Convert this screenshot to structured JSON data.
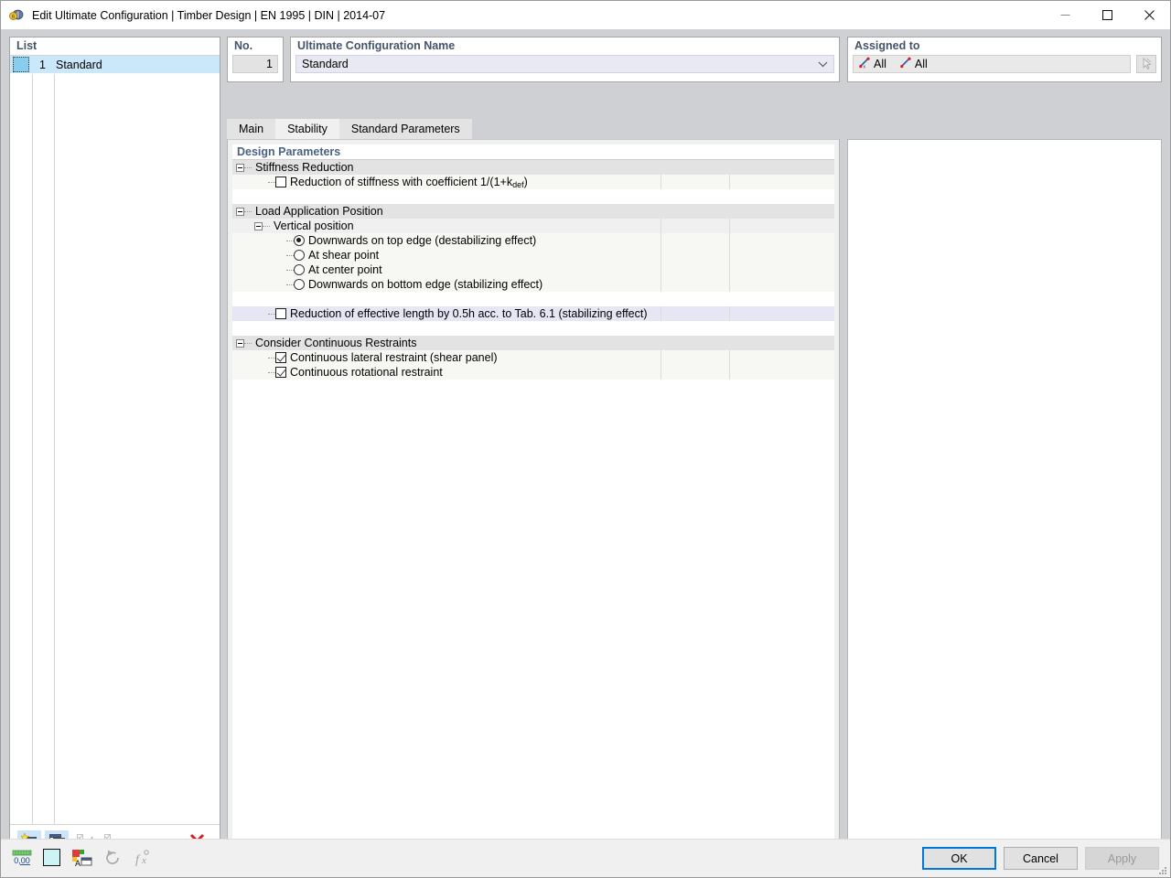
{
  "window": {
    "title": "Edit Ultimate Configuration | Timber Design | EN 1995 | DIN | 2014-07",
    "icon": "app-icon",
    "minimize": "—",
    "maximize": "□",
    "close": "✕"
  },
  "list": {
    "header": "List",
    "rows": [
      {
        "num": "1",
        "name": "Standard"
      }
    ],
    "toolbar": [
      {
        "name": "new-configuration-button",
        "label": ""
      },
      {
        "name": "copy-configuration-button",
        "label": ""
      },
      {
        "name": "select-all-button",
        "label": ""
      },
      {
        "name": "deselect-button",
        "label": ""
      },
      {
        "name": "delete-configuration-button",
        "label": "✕"
      }
    ]
  },
  "number_field": {
    "label": "No.",
    "value": "1"
  },
  "name_field": {
    "label": "Ultimate Configuration Name",
    "value": "Standard"
  },
  "assigned": {
    "label": "Assigned to",
    "items": [
      {
        "icon": "member-icon",
        "text": "All"
      },
      {
        "icon": "surface-icon",
        "text": "All"
      }
    ],
    "pick_icon": "pick-cursor-icon"
  },
  "tabs": [
    {
      "label": "Main",
      "active": false
    },
    {
      "label": "Stability",
      "active": true
    },
    {
      "label": "Standard Parameters",
      "active": false
    }
  ],
  "table": {
    "title": "Design Parameters",
    "rows": [
      {
        "kind": "group",
        "indent": 0,
        "label": "Stiffness Reduction"
      },
      {
        "kind": "check",
        "indent": 2,
        "label": "Reduction of stiffness with coefficient 1/(1+k",
        "sub": "def",
        "label_tail": ")",
        "checked": false
      },
      {
        "kind": "blank"
      },
      {
        "kind": "group",
        "indent": 0,
        "label": "Load Application Position"
      },
      {
        "kind": "sub",
        "indent": 1,
        "label": "Vertical position"
      },
      {
        "kind": "radio",
        "indent": 3,
        "label": "Downwards on top edge (destabilizing effect)",
        "selected": true
      },
      {
        "kind": "radio",
        "indent": 3,
        "label": "At shear point",
        "selected": false
      },
      {
        "kind": "radio",
        "indent": 3,
        "label": "At center point",
        "selected": false
      },
      {
        "kind": "radio",
        "indent": 3,
        "label": "Downwards on bottom edge (stabilizing effect)",
        "selected": false
      },
      {
        "kind": "blank"
      },
      {
        "kind": "check-hl",
        "indent": 2,
        "label": "Reduction of effective length by 0.5h acc. to Tab. 6.1 (stabilizing effect)",
        "checked": false
      },
      {
        "kind": "blank"
      },
      {
        "kind": "group",
        "indent": 0,
        "label": "Consider Continuous Restraints"
      },
      {
        "kind": "check",
        "indent": 2,
        "label": "Continuous lateral restraint (shear panel)",
        "checked": true
      },
      {
        "kind": "check",
        "indent": 2,
        "label": "Continuous rotational restraint",
        "checked": true
      }
    ]
  },
  "bottom": {
    "tools": [
      {
        "name": "decimal-places-button",
        "label": "0,00"
      },
      {
        "name": "color-swatch-button",
        "label": ""
      },
      {
        "name": "display-properties-button",
        "label": ""
      },
      {
        "name": "reset-button",
        "label": ""
      },
      {
        "name": "formula-button",
        "label": ""
      }
    ],
    "buttons": [
      {
        "name": "ok-button",
        "label": "OK",
        "style": "primary",
        "enabled": true
      },
      {
        "name": "cancel-button",
        "label": "Cancel",
        "style": "normal",
        "enabled": true
      },
      {
        "name": "apply-button",
        "label": "Apply",
        "style": "disabled",
        "enabled": false
      }
    ]
  },
  "colors": {
    "accent": "#0078d7",
    "header_text": "#44546a",
    "selection": "#cbe8fa",
    "highlight_row": "#e6e6f4"
  }
}
